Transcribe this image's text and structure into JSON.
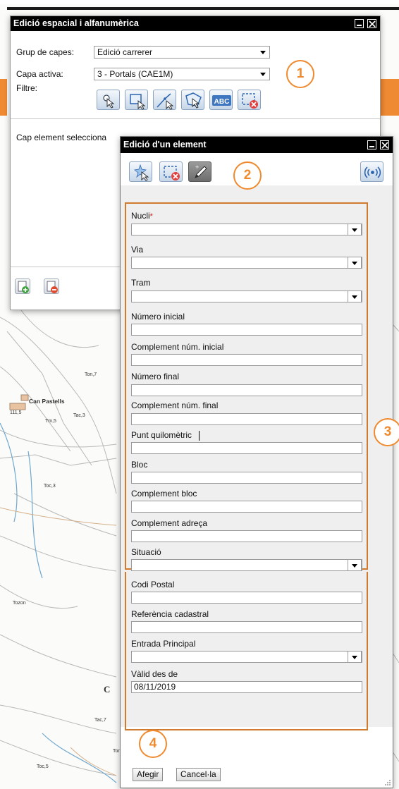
{
  "window_main": {
    "title": "Edició espacial i alfanumèrica",
    "layer_group_label": "Grup de capes:",
    "layer_group_value": "Edició carrerer",
    "active_layer_label": "Capa activa:",
    "active_layer_value": "3 - Portals (CAE1M)",
    "filter_label": "Filtre:",
    "filter_tools": [
      "point-select-icon",
      "rectangle-select-icon",
      "line-select-icon",
      "polygon-select-icon",
      "text-search-icon",
      "clear-selection-icon"
    ],
    "abc_text": "ABC",
    "selection_text": "Cap element selecciona",
    "footer_buttons": [
      "add-layer-icon",
      "remove-layer-icon"
    ]
  },
  "window_edit": {
    "title": "Edició d'un element",
    "toolbar": [
      "new-element-icon",
      "delete-element-icon",
      "edit-element-icon",
      "gps-icon"
    ],
    "fields": [
      {
        "label": "Nucli",
        "required_mark": "*",
        "type": "select",
        "value": ""
      },
      {
        "label": "Via",
        "type": "select",
        "value": ""
      },
      {
        "label": "Tram",
        "type": "select",
        "value": ""
      },
      {
        "label": "Número inicial",
        "type": "text",
        "value": ""
      },
      {
        "label": "Complement núm. inicial",
        "type": "text",
        "value": ""
      },
      {
        "label": "Número final",
        "type": "text",
        "value": ""
      },
      {
        "label": "Complement núm. final",
        "type": "text",
        "value": ""
      },
      {
        "label": "Punt quilomètric",
        "type": "text",
        "value": ""
      },
      {
        "label": "Bloc",
        "type": "text",
        "value": ""
      },
      {
        "label": "Complement bloc",
        "type": "text",
        "value": ""
      },
      {
        "label": "Complement adreça",
        "type": "text",
        "value": ""
      },
      {
        "label": "Situació",
        "type": "select",
        "value": ""
      },
      {
        "label": "Codi Postal",
        "type": "text",
        "value": ""
      },
      {
        "label": "Referència cadastral",
        "type": "text",
        "value": ""
      },
      {
        "label": "Entrada Principal",
        "type": "select",
        "value": ""
      },
      {
        "label": "Vàlid des de",
        "type": "text",
        "value": "08/11/2019"
      }
    ],
    "add_button": "Afegir",
    "cancel_button": "Cancel·la"
  },
  "callouts": [
    "1",
    "2",
    "3",
    "4"
  ],
  "map_labels": {
    "place_name": "Can Pastells",
    "letter": "C",
    "elevation_1": "111,5",
    "elevation_2": "Ton,7",
    "elevation_3": "Tm,5",
    "elevation_4": "Tac,3",
    "elevation_5": "Toc,3",
    "elevation_6": "Toc,5",
    "elevation_7": "Tozon",
    "elevation_8": "Tac,7",
    "elevation_9": "Tom"
  },
  "colors": {
    "accent_orange": "#ef8a2e",
    "titlebar": "#000000",
    "form_border": "#d07a30"
  }
}
